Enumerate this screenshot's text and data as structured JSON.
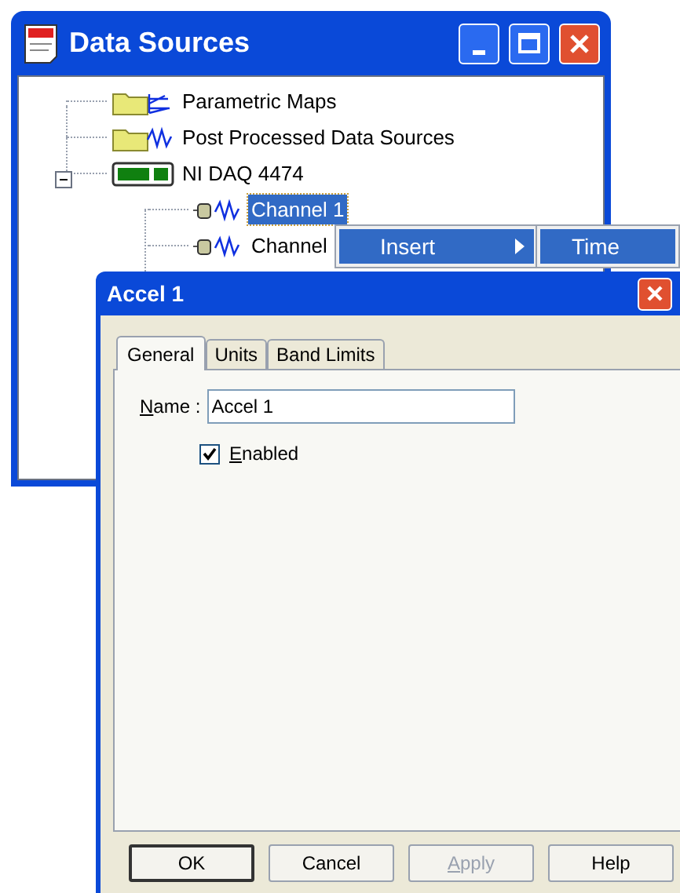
{
  "main_window": {
    "title": "Data Sources"
  },
  "tree": [
    {
      "label": "Parametric Maps",
      "kind": "folder-spectrum",
      "selected": false
    },
    {
      "label": "Post Processed Data Sources",
      "kind": "folder-wave",
      "selected": false
    },
    {
      "label": "NI DAQ 4474",
      "kind": "device",
      "selected": false,
      "expanded": true,
      "children": [
        {
          "label": "Channel 1",
          "kind": "channel",
          "selected": true
        },
        {
          "label": "Channel",
          "kind": "channel",
          "selected": false
        }
      ]
    }
  ],
  "context_menu": {
    "items": [
      {
        "label": "Insert",
        "has_submenu": true
      }
    ],
    "submenu": {
      "items": [
        {
          "label": "Time",
          "selected": true
        }
      ]
    }
  },
  "dialog": {
    "title": "Accel 1",
    "tabs": [
      {
        "label": "General",
        "selected": true
      },
      {
        "label": "Units",
        "selected": false
      },
      {
        "label": "Band Limits",
        "selected": false
      }
    ],
    "name_label": "Name :",
    "name_value": "Accel 1",
    "enabled": {
      "label": "Enabled",
      "checked": true
    },
    "buttons": [
      {
        "label": "OK",
        "default": true,
        "disabled": false
      },
      {
        "label": "Cancel",
        "default": false,
        "disabled": false
      },
      {
        "label": "Apply",
        "default": false,
        "disabled": true
      },
      {
        "label": "Help",
        "default": false,
        "disabled": false
      }
    ]
  }
}
